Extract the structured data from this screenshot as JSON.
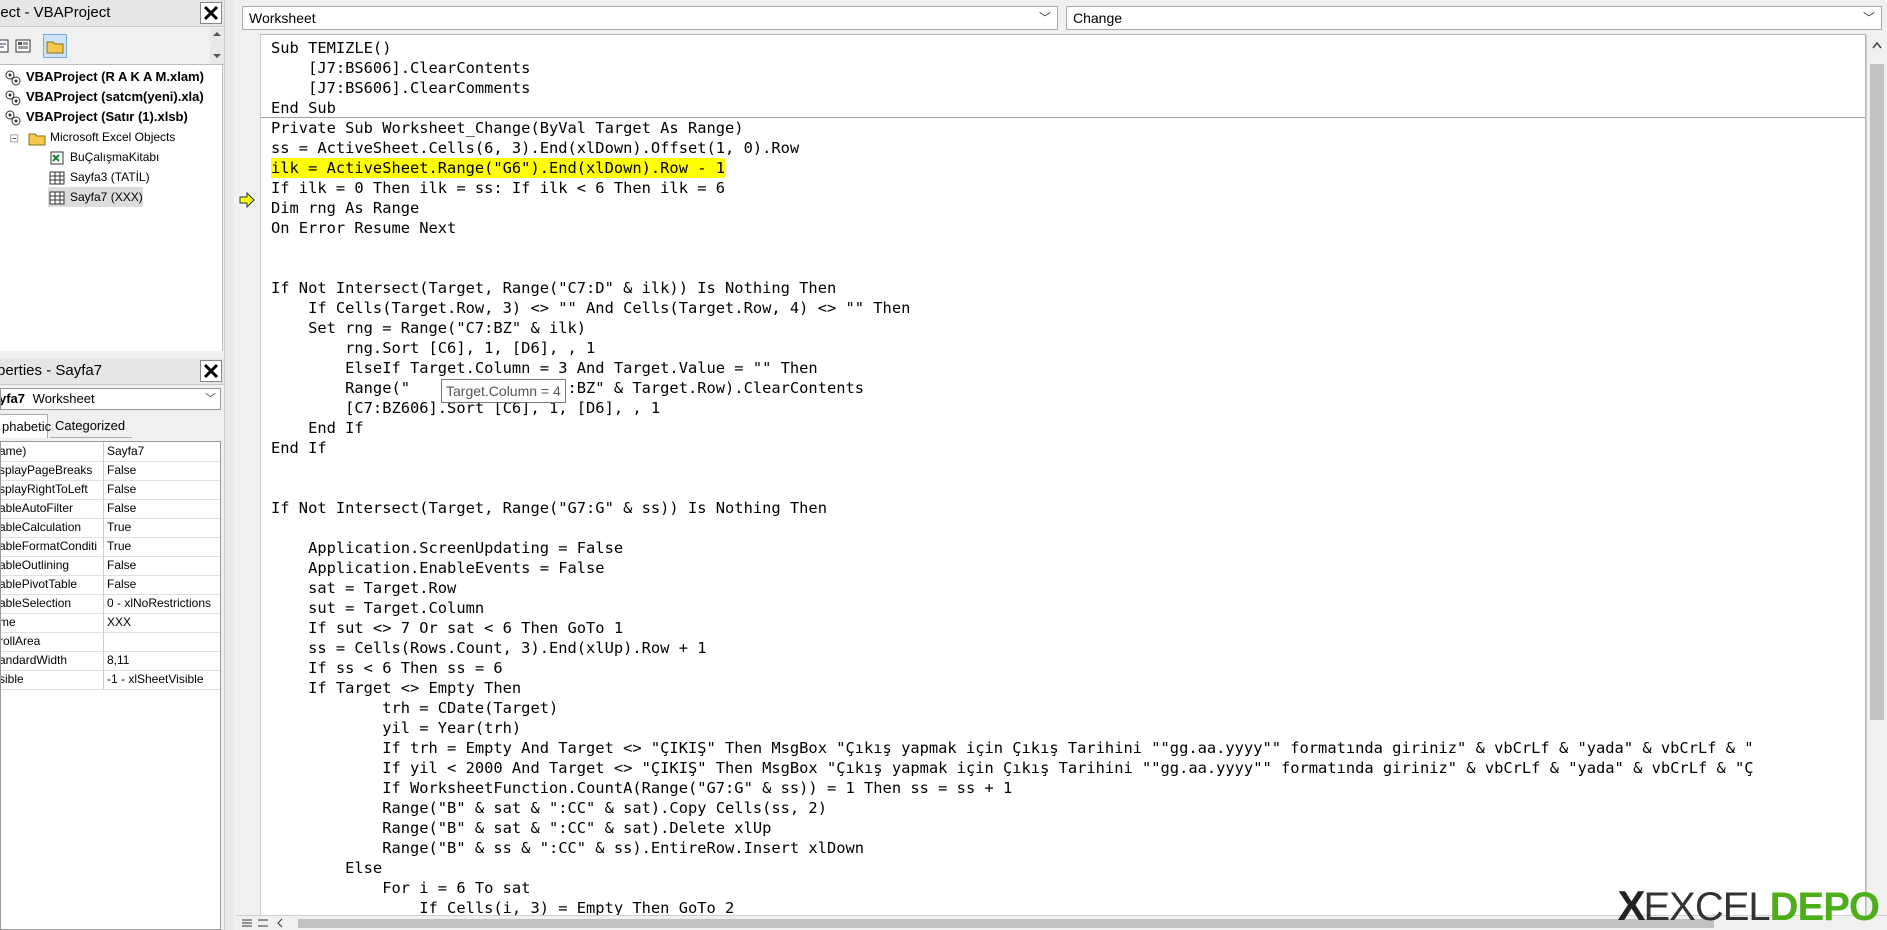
{
  "project_panel": {
    "title": "ject - VBAProject",
    "tree": [
      {
        "label": "VBAProject (R A K A M.xlam)",
        "bold": true,
        "level": 0,
        "icon": "vba-project-icon"
      },
      {
        "label": "VBAProject (satcm(yeni).xla)",
        "bold": true,
        "level": 0,
        "icon": "vba-project-icon"
      },
      {
        "label": "VBAProject (Satır (1).xlsb)",
        "bold": true,
        "level": 0,
        "icon": "vba-project-icon"
      },
      {
        "label": "Microsoft Excel Objects",
        "bold": false,
        "level": 1,
        "icon": "folder-icon"
      },
      {
        "label": "BuÇalışmaKitabı",
        "bold": false,
        "level": 2,
        "icon": "workbook-icon"
      },
      {
        "label": "Sayfa3 (TATİL)",
        "bold": false,
        "level": 2,
        "icon": "sheet-icon"
      },
      {
        "label": "Sayfa7 (XXX)",
        "bold": false,
        "level": 2,
        "icon": "sheet-icon"
      }
    ]
  },
  "properties_panel": {
    "title": "perties - Sayfa7",
    "object_name": "yfa7",
    "object_type": "Worksheet",
    "tab_alphabetic": "phabetic",
    "tab_categorized": "Categorized",
    "rows": [
      {
        "key": "ame)",
        "value": "Sayfa7"
      },
      {
        "key": "splayPageBreaks",
        "value": "False"
      },
      {
        "key": "splayRightToLeft",
        "value": "False"
      },
      {
        "key": "ableAutoFilter",
        "value": "False"
      },
      {
        "key": "ableCalculation",
        "value": "True"
      },
      {
        "key": "ableFormatConditi",
        "value": "True"
      },
      {
        "key": "ableOutlining",
        "value": "False"
      },
      {
        "key": "ablePivotTable",
        "value": "False"
      },
      {
        "key": "ableSelection",
        "value": "0 - xlNoRestrictions"
      },
      {
        "key": "me",
        "value": "XXX"
      },
      {
        "key": "rollArea",
        "value": ""
      },
      {
        "key": "andardWidth",
        "value": "8,11"
      },
      {
        "key": "sible",
        "value": "-1 - xlSheetVisible"
      }
    ]
  },
  "code_window": {
    "object_combo": "Worksheet",
    "procedure_combo": "Change",
    "tooltip": "Target.Column = 4",
    "lines": [
      "Sub TEMIZLE()",
      "    [J7:BS606].ClearContents",
      "    [J7:BS606].ClearComments",
      "End Sub",
      "Private Sub Worksheet_Change(ByVal Target As Range)",
      "ss = ActiveSheet.Cells(6, 3).End(xlDown).Offset(1, 0).Row",
      "ilk = ActiveSheet.Range(\"G6\").End(xlDown).Row - 1",
      "If ilk = 0 Then ilk = ss: If ilk < 6 Then ilk = 6",
      "Dim rng As Range",
      "On Error Resume Next",
      "",
      "",
      "If Not Intersect(Target, Range(\"C7:D\" & ilk)) Is Nothing Then",
      "    If Cells(Target.Row, 3) <> \"\" And Cells(Target.Row, 4) <> \"\" Then",
      "    Set rng = Range(\"C7:BZ\" & ilk)",
      "        rng.Sort [C6], 1, [D6], , 1",
      "        ElseIf Target.Column = 3 And Target.Value = \"\" Then",
      "        Range(\"           ow & \":BZ\" & Target.Row).ClearContents",
      "        [C7:BZ606].Sort [C6], 1, [D6], , 1",
      "    End If",
      "End If",
      "",
      "",
      "If Not Intersect(Target, Range(\"G7:G\" & ss)) Is Nothing Then",
      "",
      "    Application.ScreenUpdating = False",
      "    Application.EnableEvents = False",
      "    sat = Target.Row",
      "    sut = Target.Column",
      "    If sut <> 7 Or sat < 6 Then GoTo 1",
      "    ss = Cells(Rows.Count, 3).End(xlUp).Row + 1",
      "    If ss < 6 Then ss = 6",
      "    If Target <> Empty Then",
      "            trh = CDate(Target)",
      "            yil = Year(trh)",
      "            If trh = Empty And Target <> \"ÇIKIŞ\" Then MsgBox \"Çıkış yapmak için Çıkış Tarihini \"\"gg.aa.yyyy\"\" formatında giriniz\" & vbCrLf & \"yada\" & vbCrLf & \"",
      "            If yil < 2000 And Target <> \"ÇIKIŞ\" Then MsgBox \"Çıkış yapmak için Çıkış Tarihini \"\"gg.aa.yyyy\"\" formatında giriniz\" & vbCrLf & \"yada\" & vbCrLf & \"Ç",
      "            If WorksheetFunction.CountA(Range(\"G7:G\" & ss)) = 1 Then ss = ss + 1",
      "            Range(\"B\" & sat & \":CC\" & sat).Copy Cells(ss, 2)",
      "            Range(\"B\" & sat & \":CC\" & sat).Delete xlUp",
      "            Range(\"B\" & ss & \":CC\" & ss).EntireRow.Insert xlDown",
      "        Else",
      "            For i = 6 To sat",
      "                If Cells(i, 3) = Empty Then GoTo 2"
    ],
    "highlighted_line_index": 6
  },
  "watermark": {
    "x": "X",
    "excel": "EXCEL",
    "depo": "DEPO"
  }
}
